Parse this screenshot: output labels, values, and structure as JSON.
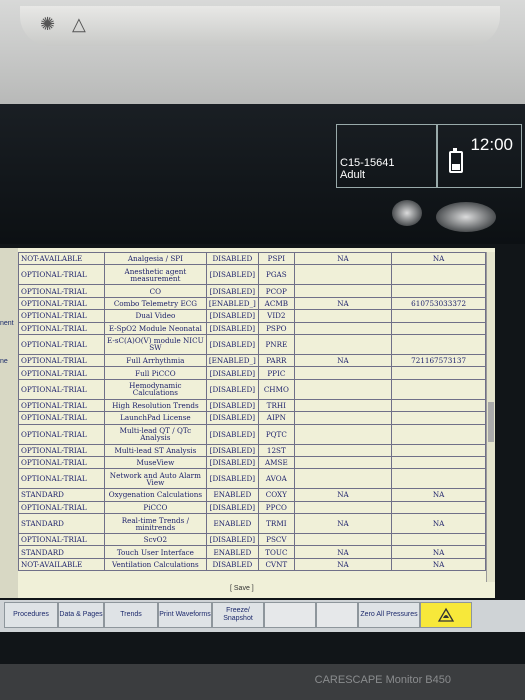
{
  "patient": {
    "id": "C15-15641",
    "category": "Adult"
  },
  "clock": "12:00",
  "left_edge": [
    "nent",
    "ne"
  ],
  "table": {
    "rows": [
      {
        "status": "NOT-AVAILABLE",
        "feature": "Analgesia / SPI",
        "state": "DISABLED",
        "code": "PSPI",
        "v1": "NA",
        "v2": "NA",
        "tall": false
      },
      {
        "status": "OPTIONAL-TRIAL",
        "feature": "Anesthetic agent measurement",
        "state": "[DISABLED]",
        "code": "PGAS",
        "v1": "",
        "v2": "",
        "tall": true
      },
      {
        "status": "OPTIONAL-TRIAL",
        "feature": "CO",
        "state": "[DISABLED]",
        "code": "PCOP",
        "v1": "",
        "v2": "",
        "tall": false
      },
      {
        "status": "OPTIONAL-TRIAL",
        "feature": "Combo Telemetry ECG",
        "state": "[ENABLED_]",
        "code": "ACMB",
        "v1": "NA",
        "v2": "610753033372",
        "tall": false
      },
      {
        "status": "OPTIONAL-TRIAL",
        "feature": "Dual Video",
        "state": "[DISABLED]",
        "code": "VID2",
        "v1": "",
        "v2": "",
        "tall": false
      },
      {
        "status": "OPTIONAL-TRIAL",
        "feature": "E-SpO2 Module Neonatal",
        "state": "[DISABLED]",
        "code": "PSPO",
        "v1": "",
        "v2": "",
        "tall": false
      },
      {
        "status": "OPTIONAL-TRIAL",
        "feature": "E-sC(A)O(V) module NICU SW",
        "state": "[DISABLED]",
        "code": "PNRE",
        "v1": "",
        "v2": "",
        "tall": true
      },
      {
        "status": "OPTIONAL-TRIAL",
        "feature": "Full Arrhythmia",
        "state": "[ENABLED_]",
        "code": "PARR",
        "v1": "NA",
        "v2": "721167573137",
        "tall": false
      },
      {
        "status": "OPTIONAL-TRIAL",
        "feature": "Full PiCCO",
        "state": "[DISABLED]",
        "code": "PPIC",
        "v1": "",
        "v2": "",
        "tall": false
      },
      {
        "status": "OPTIONAL-TRIAL",
        "feature": "Hemodynamic Calculations",
        "state": "[DISABLED]",
        "code": "CHMO",
        "v1": "",
        "v2": "",
        "tall": true
      },
      {
        "status": "OPTIONAL-TRIAL",
        "feature": "High Resolution Trends",
        "state": "[DISABLED]",
        "code": "TRHI",
        "v1": "",
        "v2": "",
        "tall": false
      },
      {
        "status": "OPTIONAL-TRIAL",
        "feature": "LaunchPad License",
        "state": "[DISABLED]",
        "code": "AIPN",
        "v1": "",
        "v2": "",
        "tall": false
      },
      {
        "status": "OPTIONAL-TRIAL",
        "feature": "Multi-lead QT / QTc Analysis",
        "state": "[DISABLED]",
        "code": "PQTC",
        "v1": "",
        "v2": "",
        "tall": true
      },
      {
        "status": "OPTIONAL-TRIAL",
        "feature": "Multi-lead ST Analysis",
        "state": "[DISABLED]",
        "code": "12ST",
        "v1": "",
        "v2": "",
        "tall": false
      },
      {
        "status": "OPTIONAL-TRIAL",
        "feature": "MuseView",
        "state": "[DISABLED]",
        "code": "AMSE",
        "v1": "",
        "v2": "",
        "tall": false
      },
      {
        "status": "OPTIONAL-TRIAL",
        "feature": "Network and Auto Alarm View",
        "state": "[DISABLED]",
        "code": "AVOA",
        "v1": "",
        "v2": "",
        "tall": true
      },
      {
        "status": "STANDARD",
        "feature": "Oxygenation Calculations",
        "state": "ENABLED",
        "code": "COXY",
        "v1": "NA",
        "v2": "NA",
        "tall": false
      },
      {
        "status": "OPTIONAL-TRIAL",
        "feature": "PiCCO",
        "state": "[DISABLED]",
        "code": "PPCO",
        "v1": "",
        "v2": "",
        "tall": false
      },
      {
        "status": "STANDARD",
        "feature": "Real-time Trends / minitrends",
        "state": "ENABLED",
        "code": "TRMI",
        "v1": "NA",
        "v2": "NA",
        "tall": true
      },
      {
        "status": "OPTIONAL-TRIAL",
        "feature": "ScvO2",
        "state": "[DISABLED]",
        "code": "PSCV",
        "v1": "",
        "v2": "",
        "tall": false
      },
      {
        "status": "STANDARD",
        "feature": "Touch User Interface",
        "state": "ENABLED",
        "code": "TOUC",
        "v1": "NA",
        "v2": "NA",
        "tall": false
      },
      {
        "status": "NOT-AVAILABLE",
        "feature": "Ventilation Calculations",
        "state": "DISABLED",
        "code": "CVNT",
        "v1": "NA",
        "v2": "NA",
        "tall": false
      }
    ]
  },
  "save_label": "[ Save ]",
  "buttons": {
    "procedures": "Procedures",
    "data_pages": "Data & Pages",
    "trends": "Trends",
    "print_waveforms": "Print Waveforms",
    "freeze_snapshot": "Freeze/ Snapshot",
    "zero_all_pressures": "Zero All Pressures"
  },
  "brand": "CARESCAPE Monitor B450"
}
